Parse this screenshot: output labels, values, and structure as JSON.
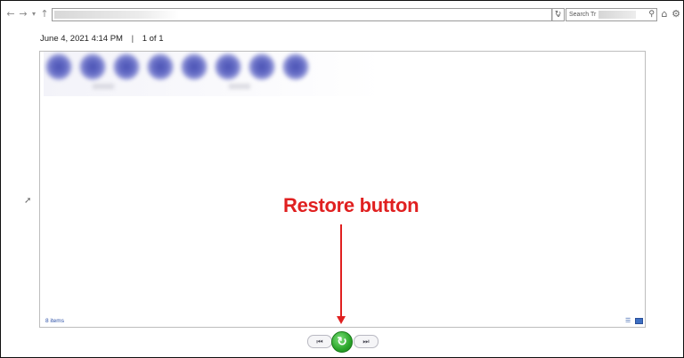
{
  "toolbar": {
    "back_icon": "←",
    "forward_icon": "→",
    "dropdown_icon": "▾",
    "up_icon": "↑",
    "address_dropdown_icon": "⌄",
    "refresh_icon": "↻",
    "search_placeholder": "Search Tr",
    "search_icon": "⚲",
    "home_icon": "⌂",
    "settings_icon": "⚙"
  },
  "header": {
    "date": "June 4, 2021 4:14 PM",
    "separator": "|",
    "page_info": "1 of 1"
  },
  "panel": {
    "items_count": "8 items",
    "details_view_icon": "☰",
    "large_view_icon": ""
  },
  "annotation": {
    "label": "Restore button"
  },
  "controls": {
    "previous_icon": "⏮",
    "restore_icon": "↻",
    "next_icon": "⏭"
  },
  "colors": {
    "annotation": "#e02020",
    "restore_green": "#2aa52a",
    "link_blue": "#2b4fa6"
  }
}
